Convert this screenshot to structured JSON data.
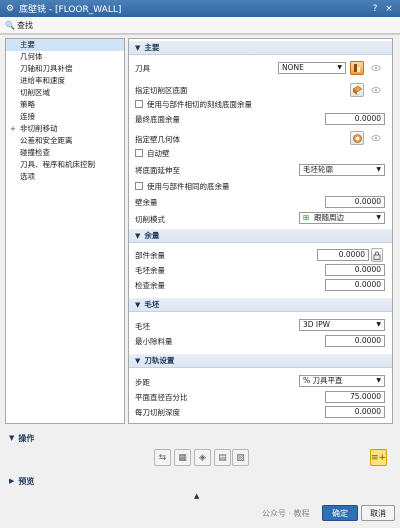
{
  "window": {
    "title": "底壁铣 - [FLOOR_WALL]",
    "help_label": "?",
    "close_label": "×"
  },
  "search": {
    "label": "查找"
  },
  "nav": {
    "items": [
      {
        "label": "主要",
        "expander": ""
      },
      {
        "label": "几何体",
        "expander": ""
      },
      {
        "label": "刀轴和刀具补偿",
        "expander": ""
      },
      {
        "label": "进给率和速度",
        "expander": ""
      },
      {
        "label": "切削区域",
        "expander": ""
      },
      {
        "label": "策略",
        "expander": ""
      },
      {
        "label": "连接",
        "expander": ""
      },
      {
        "label": "非切削移动",
        "expander": "+"
      },
      {
        "label": "公差和安全距离",
        "expander": ""
      },
      {
        "label": "碰撞检查",
        "expander": ""
      },
      {
        "label": "刀具、程序和机床控制",
        "expander": ""
      },
      {
        "label": "选项",
        "expander": ""
      }
    ]
  },
  "main": {
    "header": "主要",
    "tool_label": "刀具",
    "tool_value": "NONE",
    "cut_area_label": "指定切削区底面",
    "auto_wall_label": "使用与部件相切的刻线底面余量",
    "floor_stock_label": "最终底面余量",
    "floor_stock_value": "0.0000",
    "wall_geom_label": "指定壁几何体",
    "auto_wall2_label": "自动壁",
    "extend_label": "将底面延伸至",
    "extend_value": "毛坯轮廓",
    "same_stock_label": "使用与部件相同的底余量",
    "wall_stock_label": "壁余量",
    "wall_stock_value": "0.0000",
    "cut_mode_label": "切削模式",
    "cut_mode_value": "跟随周边"
  },
  "stock": {
    "header": "余量",
    "part_label": "部件余量",
    "part_value": "0.0000",
    "blank_label": "毛坯余量",
    "blank_value": "0.0000",
    "check_label": "检查余量",
    "check_value": "0.0000"
  },
  "blank": {
    "header": "毛坯",
    "blank_label": "毛坯",
    "blank_value": "3D IPW",
    "min_remove_label": "最小除料量",
    "min_remove_value": "0.0000"
  },
  "toolpath": {
    "header": "刀轨设置",
    "stepover_label": "步距",
    "stepover_value": "% 刀具平直",
    "percent_label": "平面直径百分比",
    "percent_value": "75.0000",
    "depth_label": "每刀切削深度",
    "depth_value": "0.0000"
  },
  "operations": {
    "label": "操作"
  },
  "preview": {
    "label": "预览"
  },
  "footer": {
    "watermark": "公众号 · 教程",
    "ok_label": "确定",
    "cancel_label": "取消"
  }
}
